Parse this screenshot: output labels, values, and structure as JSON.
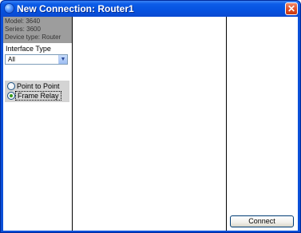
{
  "window": {
    "title": "New Connection: Router1",
    "close_symbol": "✕"
  },
  "device": {
    "model": "Model: 3640",
    "series": "Series: 3600",
    "type": "Device type: Router"
  },
  "interface_type": {
    "label": "Interface Type",
    "selected": "All",
    "arrow": "▼"
  },
  "connection_types": [
    {
      "label": "Point to Point",
      "checked": false
    },
    {
      "label": "Frame Relay",
      "checked": true
    }
  ],
  "actions": {
    "connect_label": "Connect"
  },
  "icons": {
    "title": "app-globe-icon",
    "close": "close-icon",
    "dropdown": "chevron-down-icon"
  },
  "colors": {
    "titlebar": "#0652e0",
    "close_button": "#e0502a",
    "info_panel": "#9d9d9d",
    "radio_panel": "#d4d4d4"
  }
}
